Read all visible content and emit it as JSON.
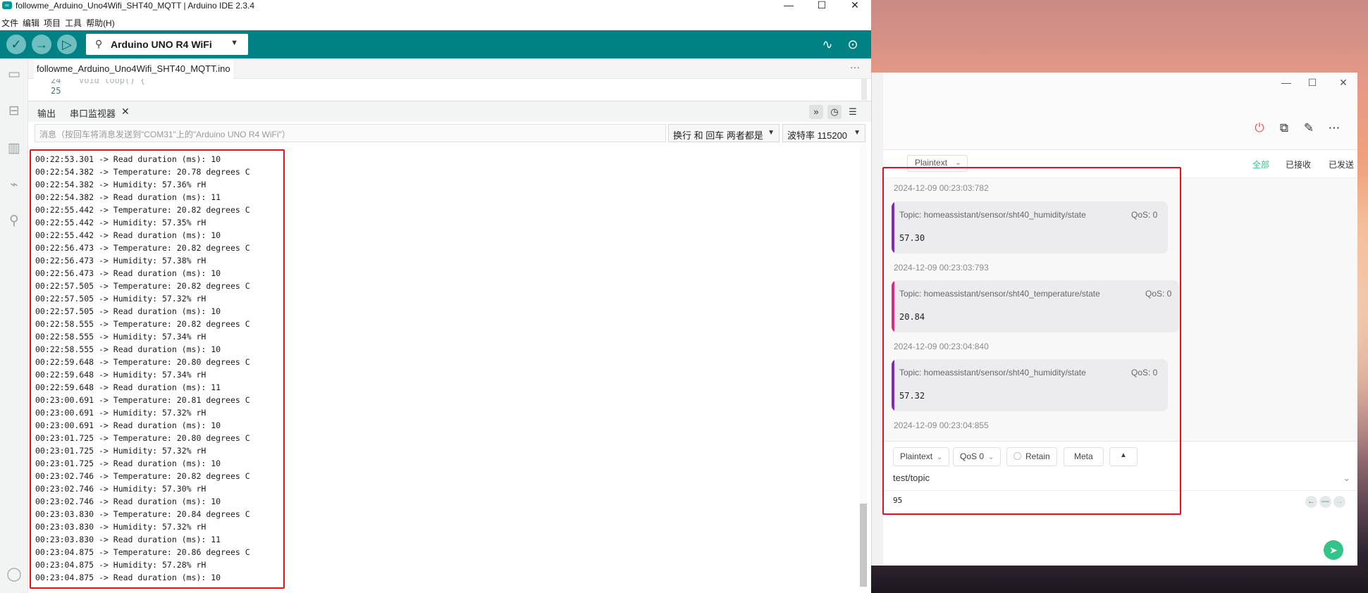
{
  "ide": {
    "window_title": "followme_Arduino_Uno4Wifi_SHT40_MQTT | Arduino IDE 2.3.4",
    "app_icon": "∞",
    "window_controls": {
      "minimize": "—",
      "maximize": "☐",
      "close": "✕"
    },
    "menu": [
      "文件",
      "编辑",
      "项目",
      "工具",
      "帮助(H)"
    ],
    "toolbar": {
      "verify_icon": "✓",
      "upload_icon": "→",
      "debug_icon": "▷",
      "usb_icon": "⚲",
      "board": "Arduino UNO R4 WiFi",
      "board_caret": "▼",
      "serial_plotter_icon": "∿",
      "serial_monitor_icon": "⊙"
    },
    "rail_icons": [
      "folder-icon",
      "boards-icon",
      "library-icon",
      "debug-icon",
      "search-icon",
      "profile-icon"
    ],
    "rail_glyphs": {
      "folder": "▭",
      "boards": "⊟",
      "library": "▥",
      "debug": "⌁",
      "search": "⚲",
      "profile": "◯"
    },
    "file_tab": "followme_Arduino_Uno4Wifi_SHT40_MQTT.ino",
    "file_tab_more": "···",
    "editor": {
      "line_top": "24",
      "line_bottom": "25",
      "code_fragment": "void loop() {"
    },
    "panel": {
      "tab_output": "输出",
      "tab_serial": "串口监视器",
      "close_icon": "✕",
      "autoscroll_icon": "»",
      "timestamp_icon": "◷",
      "clear_icon": "☰"
    },
    "serial_bar": {
      "placeholder": "消息（按回车将消息发送到\"COM31\"上的\"Arduino UNO R4 WiFi\"）",
      "line_ending": "换行 和 回车 两者都是",
      "baud_rate": "波特率 115200",
      "caret": "▼"
    },
    "serial_lines": [
      "00:22:53.301 -> Read duration (ms): 10",
      "00:22:54.382 -> Temperature: 20.78 degrees C",
      "00:22:54.382 -> Humidity: 57.36% rH",
      "00:22:54.382 -> Read duration (ms): 11",
      "00:22:55.442 -> Temperature: 20.82 degrees C",
      "00:22:55.442 -> Humidity: 57.35% rH",
      "00:22:55.442 -> Read duration (ms): 10",
      "00:22:56.473 -> Temperature: 20.82 degrees C",
      "00:22:56.473 -> Humidity: 57.38% rH",
      "00:22:56.473 -> Read duration (ms): 10",
      "00:22:57.505 -> Temperature: 20.82 degrees C",
      "00:22:57.505 -> Humidity: 57.32% rH",
      "00:22:57.505 -> Read duration (ms): 10",
      "00:22:58.555 -> Temperature: 20.82 degrees C",
      "00:22:58.555 -> Humidity: 57.34% rH",
      "00:22:58.555 -> Read duration (ms): 10",
      "00:22:59.648 -> Temperature: 20.80 degrees C",
      "00:22:59.648 -> Humidity: 57.34% rH",
      "00:22:59.648 -> Read duration (ms): 11",
      "00:23:00.691 -> Temperature: 20.81 degrees C",
      "00:23:00.691 -> Humidity: 57.32% rH",
      "00:23:00.691 -> Read duration (ms): 10",
      "00:23:01.725 -> Temperature: 20.80 degrees C",
      "00:23:01.725 -> Humidity: 57.32% rH",
      "00:23:01.725 -> Read duration (ms): 10",
      "00:23:02.746 -> Temperature: 20.82 degrees C",
      "00:23:02.746 -> Humidity: 57.30% rH",
      "00:23:02.746 -> Read duration (ms): 10",
      "00:23:03.830 -> Temperature: 20.84 degrees C",
      "00:23:03.830 -> Humidity: 57.32% rH",
      "00:23:03.830 -> Read duration (ms): 11",
      "00:23:04.875 -> Temperature: 20.86 degrees C",
      "00:23:04.875 -> Humidity: 57.28% rH",
      "00:23:04.875 -> Read duration (ms): 10"
    ],
    "accent_color": "#008184"
  },
  "mqtt": {
    "window_controls": {
      "minimize": "—",
      "maximize": "☐",
      "close": "✕"
    },
    "header_icons": {
      "disconnect": "⏻",
      "new_window": "⧉",
      "edit": "✎",
      "more": "⋯"
    },
    "filter": {
      "type": "Plaintext",
      "chevron": "⌄",
      "all": "全部",
      "received": "已接收",
      "sent": "已发送"
    },
    "messages": [
      {
        "time": "2024-12-09 00:23:03:782"
      },
      {
        "topic": "Topic: homeassistant/sensor/sht40_humidity/state",
        "qos": "QoS: 0",
        "payload": "57.30",
        "bar_color": "#7b2cbf",
        "time": "2024-12-09 00:23:03:793"
      },
      {
        "topic": "Topic: homeassistant/sensor/sht40_temperature/state",
        "qos": "QoS: 0",
        "payload": "20.84",
        "bar_color": "#e0287d",
        "time": "2024-12-09 00:23:04:840"
      },
      {
        "topic": "Topic: homeassistant/sensor/sht40_humidity/state",
        "qos": "QoS: 0",
        "payload": "57.32",
        "bar_color": "#7b2cbf",
        "time": "2024-12-09 00:23:04:855"
      }
    ],
    "publish": {
      "format": "Plaintext",
      "qos": "QoS 0",
      "chevron": "⌄",
      "retain": "Retain",
      "meta": "Meta",
      "expand_icon": "▲",
      "topic": "test/topic",
      "topic_chevron": "⌄",
      "payload": "95",
      "history_back": "←",
      "history_mid": "—",
      "history_forward": "→",
      "send_icon": "➤"
    },
    "accent_color": "#34c388"
  },
  "highlight_color": "#e8101a"
}
